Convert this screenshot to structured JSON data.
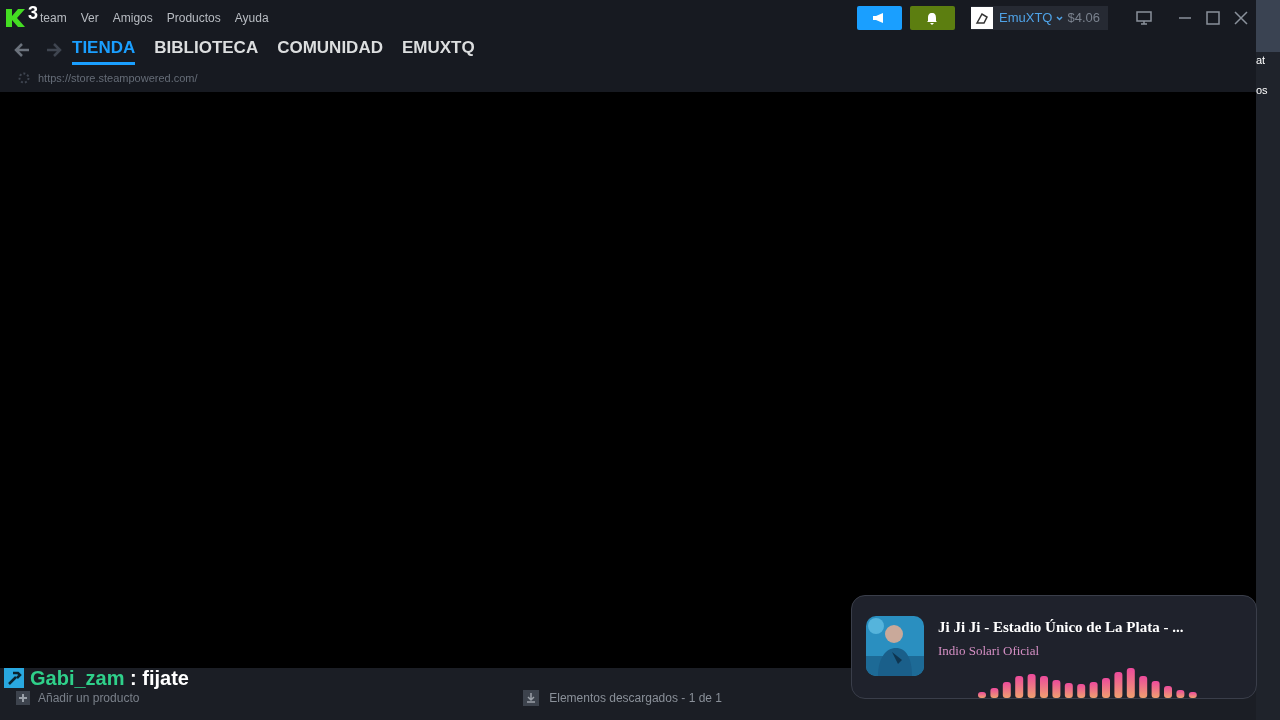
{
  "overlay_badge": {
    "count": "3"
  },
  "menu": [
    "team",
    "Ver",
    "Amigos",
    "Productos",
    "Ayuda"
  ],
  "header_buttons": [
    {
      "kind": "announcements",
      "color": "#1a9fff"
    },
    {
      "kind": "notifications",
      "color": "#5c7e10"
    }
  ],
  "account": {
    "name": "EmuXTQ",
    "balance": "$4.06"
  },
  "tabs": [
    {
      "label": "TIENDA",
      "selected": true
    },
    {
      "label": "BIBLIOTECA",
      "selected": false
    },
    {
      "label": "COMUNIDAD",
      "selected": false
    },
    {
      "label": "EMUXTQ",
      "selected": false
    }
  ],
  "url": "https://store.steampowered.com/",
  "side_window": {
    "texts": [
      "at",
      "os"
    ]
  },
  "chat_overlay": {
    "user": "Gabi_zam",
    "message": ": fijate"
  },
  "footer": {
    "add_product": "Añadir un producto",
    "downloads": "Elementos descargados - 1 de 1"
  },
  "now_playing": {
    "title": "Ji Ji Ji - Estadio Único de La Plata - ...",
    "artist": "Indio Solari Oficial"
  }
}
